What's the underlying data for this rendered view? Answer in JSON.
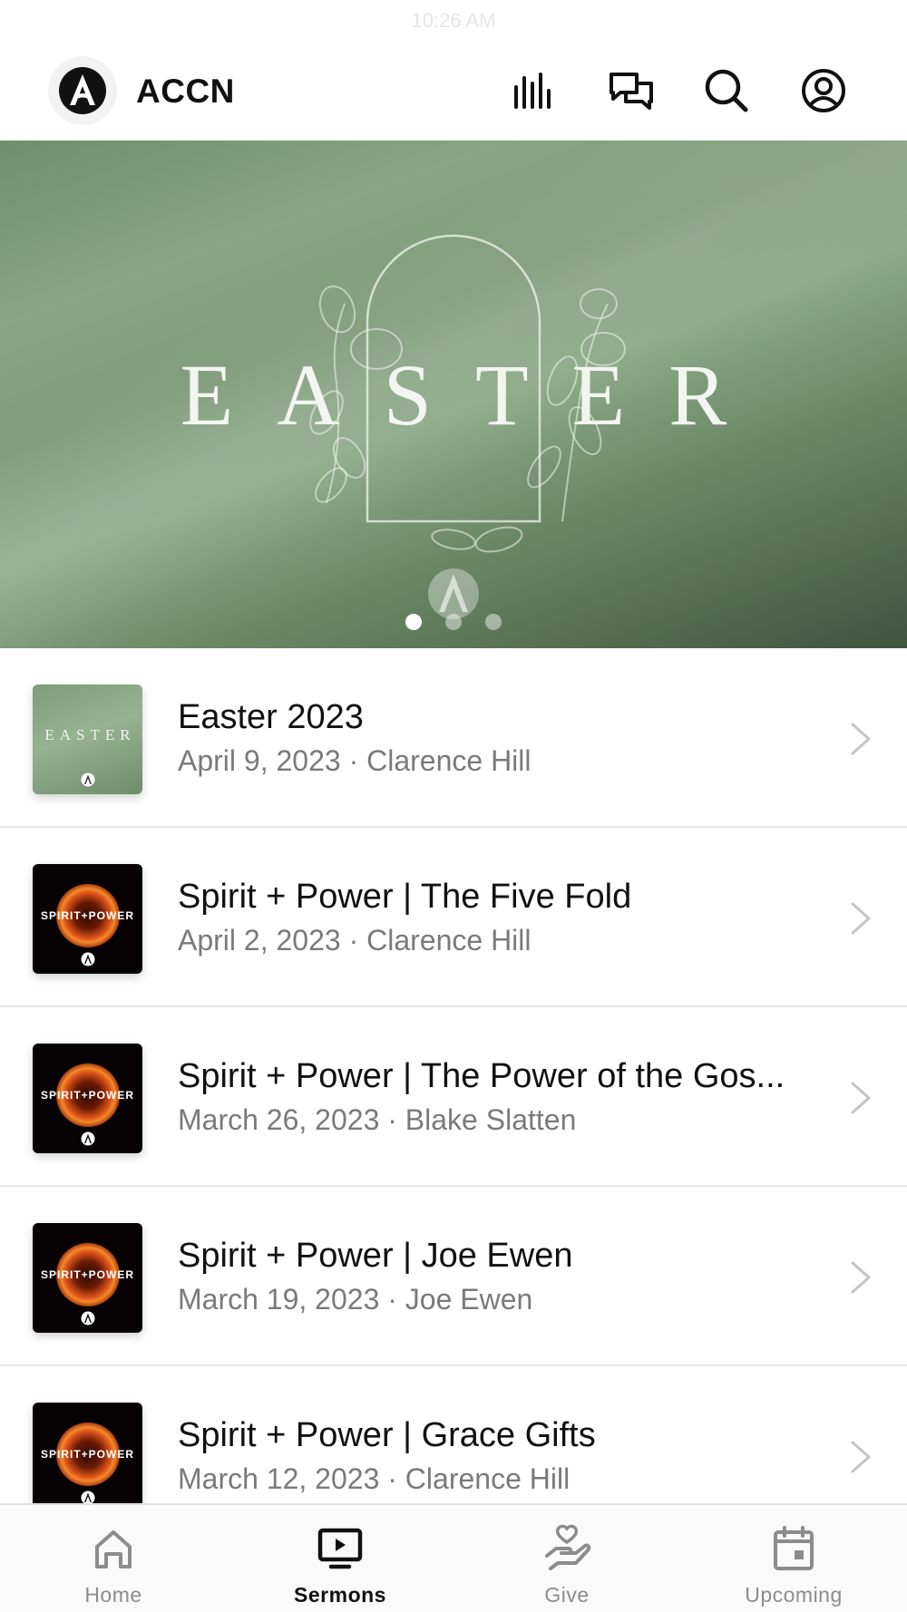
{
  "status_bar": {
    "time": "10:26 AM"
  },
  "header": {
    "app_name": "ACCN",
    "icons": [
      "audio-bars-icon",
      "chat-bubbles-icon",
      "search-icon",
      "profile-icon"
    ]
  },
  "hero": {
    "title": "EASTER",
    "slide_count": 3,
    "active_slide": 1
  },
  "sermons": [
    {
      "title": "Easter 2023",
      "date": "April 9, 2023",
      "speaker": "Clarence Hill",
      "subtitle": "April 9, 2023 · Clarence Hill",
      "thumb": "easter",
      "thumb_text": "EASTER"
    },
    {
      "title": "Spirit + Power | The Five Fold",
      "date": "April 2, 2023",
      "speaker": "Clarence Hill",
      "subtitle": "April 2, 2023 · Clarence Hill",
      "thumb": "spirit",
      "thumb_text": "SPIRIT+POWER"
    },
    {
      "title": "Spirit + Power | The Power of the Gos...",
      "date": "March 26, 2023",
      "speaker": "Blake Slatten",
      "subtitle": "March 26, 2023 · Blake Slatten",
      "thumb": "spirit",
      "thumb_text": "SPIRIT+POWER"
    },
    {
      "title": "Spirit + Power | Joe Ewen",
      "date": "March 19, 2023",
      "speaker": "Joe Ewen",
      "subtitle": "March 19, 2023 · Joe Ewen",
      "thumb": "spirit",
      "thumb_text": "SPIRIT+POWER"
    },
    {
      "title": "Spirit + Power | Grace Gifts",
      "date": "March 12, 2023",
      "speaker": "Clarence Hill",
      "subtitle": "March 12, 2023 · Clarence Hill",
      "thumb": "spirit",
      "thumb_text": "SPIRIT+POWER"
    }
  ],
  "tabbar": {
    "tabs": [
      {
        "label": "Home",
        "icon": "home-icon",
        "active": false
      },
      {
        "label": "Sermons",
        "icon": "tv-play-icon",
        "active": true
      },
      {
        "label": "Give",
        "icon": "hand-heart-icon",
        "active": false
      },
      {
        "label": "Upcoming",
        "icon": "calendar-icon",
        "active": false
      }
    ]
  },
  "colors": {
    "hero_green": "#87a583",
    "text_primary": "#111111",
    "text_secondary": "#7a7a7a",
    "tab_inactive": "#8c8c8c"
  }
}
